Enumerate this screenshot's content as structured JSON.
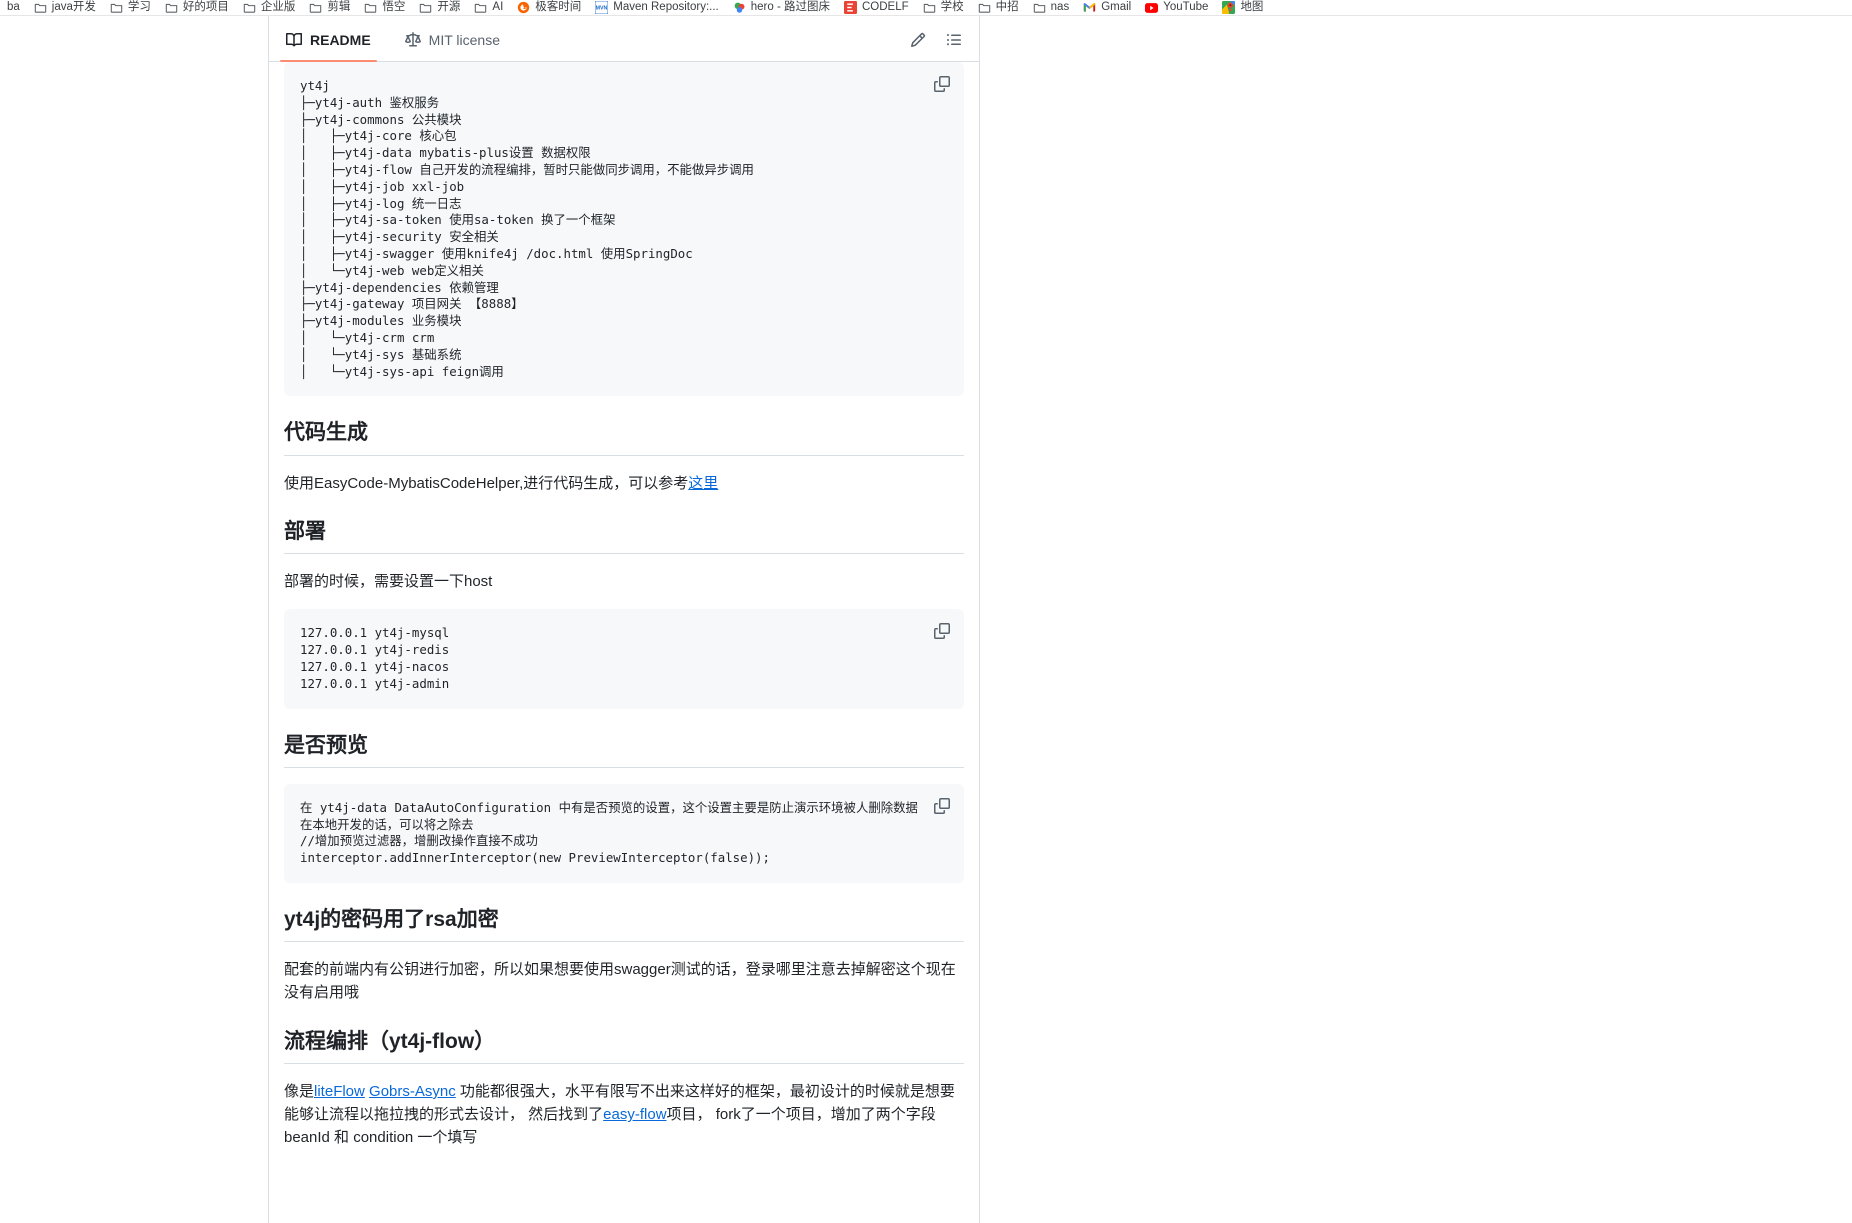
{
  "bookmarks": [
    {
      "label": "ba",
      "icon": "none"
    },
    {
      "label": "java开发",
      "icon": "folder-icon"
    },
    {
      "label": "学习",
      "icon": "folder-icon"
    },
    {
      "label": "好的项目",
      "icon": "folder-icon"
    },
    {
      "label": "企业版",
      "icon": "folder-icon"
    },
    {
      "label": "剪辑",
      "icon": "folder-icon"
    },
    {
      "label": "悟空",
      "icon": "folder-icon"
    },
    {
      "label": "开源",
      "icon": "folder-icon"
    },
    {
      "label": "AI",
      "icon": "folder-icon"
    },
    {
      "label": "极客时间",
      "icon": "geekbang-icon"
    },
    {
      "label": "Maven Repository:...",
      "icon": "maven-icon"
    },
    {
      "label": "hero - 路过图床",
      "icon": "hero-icon"
    },
    {
      "label": "CODELF",
      "icon": "codelf-icon"
    },
    {
      "label": "学校",
      "icon": "folder-icon"
    },
    {
      "label": "中招",
      "icon": "folder-icon"
    },
    {
      "label": "nas",
      "icon": "folder-icon"
    },
    {
      "label": "Gmail",
      "icon": "gmail-icon"
    },
    {
      "label": "YouTube",
      "icon": "youtube-icon"
    },
    {
      "label": "地图",
      "icon": "maps-icon"
    }
  ],
  "tabs": [
    {
      "label": "README",
      "icon": "book-icon",
      "active": true
    },
    {
      "label": "MIT license",
      "icon": "scale-icon",
      "active": false
    }
  ],
  "tab_actions": [
    {
      "name": "edit-readme-button",
      "icon": "pencil-icon"
    },
    {
      "name": "outline-button",
      "icon": "list-icon"
    }
  ],
  "colors": {
    "accent": "#0969da",
    "tab_underline": "#fd8c73",
    "code_bg": "#f6f8fa",
    "border": "#d8dee4",
    "text": "#1f2328",
    "muted": "#59636e"
  },
  "readme": {
    "tree_code": "yt4j\n├─yt4j-auth 鉴权服务\n├─yt4j-commons 公共模块\n│   ├─yt4j-core 核心包\n│   ├─yt4j-data mybatis-plus设置 数据权限\n│   ├─yt4j-flow 自己开发的流程编排，暂时只能做同步调用，不能做异步调用\n│   ├─yt4j-job xxl-job\n│   ├─yt4j-log 统一日志\n│   ├─yt4j-sa-token 使用sa-token 换了一个框架\n│   ├─yt4j-security 安全相关\n│   ├─yt4j-swagger 使用knife4j /doc.html 使用SpringDoc\n│   └─yt4j-web web定义相关\n├─yt4j-dependencies 依赖管理\n├─yt4j-gateway 项目网关 【8888】\n├─yt4j-modules 业务模块\n│   └─yt4j-crm crm\n│   └─yt4j-sys 基础系统\n│   └─yt4j-sys-api feign调用",
    "sections": [
      {
        "heading": "代码生成",
        "para_pre": "使用EasyCode-MybatisCodeHelper,进行代码生成，可以参考",
        "para_link": "这里",
        "para_post": ""
      },
      {
        "heading": "部署",
        "para_pre": "部署的时候，需要设置一下host",
        "para_link": "",
        "para_post": ""
      }
    ],
    "hosts_code": "127.0.0.1 yt4j-mysql\n127.0.0.1 yt4j-redis\n127.0.0.1 yt4j-nacos\n127.0.0.1 yt4j-admin",
    "preview_heading": "是否预览",
    "preview_code": "在 yt4j-data DataAutoConfiguration 中有是否预览的设置，这个设置主要是防止演示环境被人删除数据\n在本地开发的话，可以将之除去\n//增加预览过滤器，增删改操作直接不成功\ninterceptor.addInnerInterceptor(new PreviewInterceptor(false));",
    "rsa_heading": "yt4j的密码用了rsa加密",
    "rsa_para": "配套的前端内有公钥进行加密，所以如果想要使用swagger测试的话，登录哪里注意去掉解密这个现在没有启用哦",
    "flow_heading": "流程编排（yt4j-flow）",
    "flow_para_1a": "像是",
    "flow_link_1": "liteFlow",
    "flow_link_2": "Gobrs-Async",
    "flow_para_1b": " 功能都很强大，水平有限写不出来这样好的框架，最初设计的时候就是想要能够让流程以拖拉拽的形式去设计， 然后找到了",
    "flow_link_3": "easy-flow",
    "flow_para_1c": "项目， fork了一个项目，增加了两个字段 beanId 和 condition 一个填写"
  },
  "copy_buttons": {
    "label": "copy-icon"
  }
}
